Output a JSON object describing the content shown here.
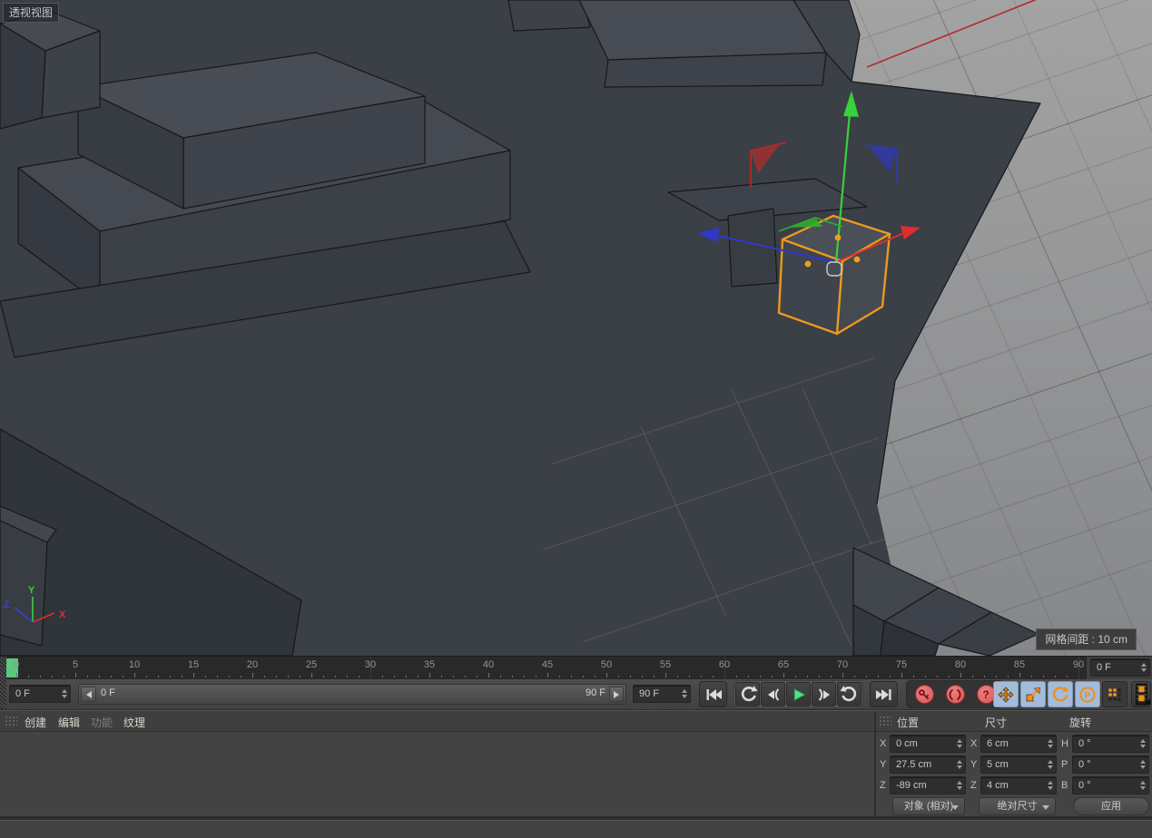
{
  "viewport": {
    "view_label": "透视视图",
    "grid_spacing_badge": "网格间距 : 10 cm",
    "axis_triad": {
      "x": "X",
      "y": "Y",
      "z": "Z"
    },
    "colors": {
      "selection_outline": "#ea9a1f",
      "axis_x": "#dd2f2f",
      "axis_y": "#35d23c",
      "axis_z": "#3038cc",
      "background_dark": "#3b3f46",
      "background_grid": "#9a9c9e"
    }
  },
  "timeline": {
    "tick_values": [
      0,
      5,
      10,
      15,
      20,
      25,
      30,
      35,
      40,
      45,
      50,
      55,
      60,
      65,
      70,
      75,
      80,
      85,
      90
    ],
    "frame_start": 0,
    "frame_end": 90,
    "playhead_frame": 0,
    "fields": {
      "current_left": "0 F",
      "slider_label": "0 F",
      "slider_end_label": "90 F",
      "range_end": "90 F",
      "current_right": "0 F"
    }
  },
  "transport": {
    "buttons": [
      {
        "id": "goto-start",
        "icon": "skip-to-start-icon"
      },
      {
        "id": "play-backward",
        "icon": "loop-backward-icon"
      },
      {
        "id": "previous-key",
        "icon": "previous-key-icon"
      },
      {
        "id": "play",
        "icon": "play-icon"
      },
      {
        "id": "next-key",
        "icon": "next-key-icon"
      },
      {
        "id": "play-loop",
        "icon": "loop-forward-icon"
      },
      {
        "id": "goto-end",
        "icon": "skip-to-end-icon"
      },
      {
        "id": "record-active-objects",
        "icon": "key-icon"
      },
      {
        "id": "autokeying",
        "icon": "parentheses-icon"
      },
      {
        "id": "keyframe-help",
        "icon": "question-icon"
      },
      {
        "id": "record-position",
        "icon": "move-arrows-icon",
        "active": true
      },
      {
        "id": "record-scale",
        "icon": "scale-box-icon",
        "active": true
      },
      {
        "id": "record-rotation",
        "icon": "rotate-arrow-icon",
        "active": true
      },
      {
        "id": "record-parameter",
        "icon": "parameter-p-icon",
        "active": true
      },
      {
        "id": "record-pla",
        "icon": "pla-dots-icon",
        "active": false
      },
      {
        "id": "motion-system",
        "icon": "filmstrip-icon"
      }
    ]
  },
  "menu_bar": {
    "items": [
      {
        "label": "创建",
        "enabled": true
      },
      {
        "label": "编辑",
        "enabled": true
      },
      {
        "label": "功能",
        "enabled": false
      },
      {
        "label": "纹理",
        "enabled": true
      }
    ]
  },
  "coordinates": {
    "headers": [
      "位置",
      "尺寸",
      "旋转"
    ],
    "position": {
      "rows": [
        {
          "axis": "X",
          "value": "0 cm"
        },
        {
          "axis": "Y",
          "value": "27.5 cm"
        },
        {
          "axis": "Z",
          "value": "-89 cm"
        }
      ]
    },
    "size": {
      "rows": [
        {
          "axis": "X",
          "value": "6 cm"
        },
        {
          "axis": "Y",
          "value": "5 cm"
        },
        {
          "axis": "Z",
          "value": "4 cm"
        }
      ]
    },
    "rotation": {
      "rows": [
        {
          "axis": "H",
          "value": "0 °"
        },
        {
          "axis": "P",
          "value": "0 °"
        },
        {
          "axis": "B",
          "value": "0 °"
        }
      ]
    },
    "mode_dropdown": "对象 (相对)",
    "size_mode_dropdown": "绝对尺寸",
    "apply_button": "应用"
  }
}
